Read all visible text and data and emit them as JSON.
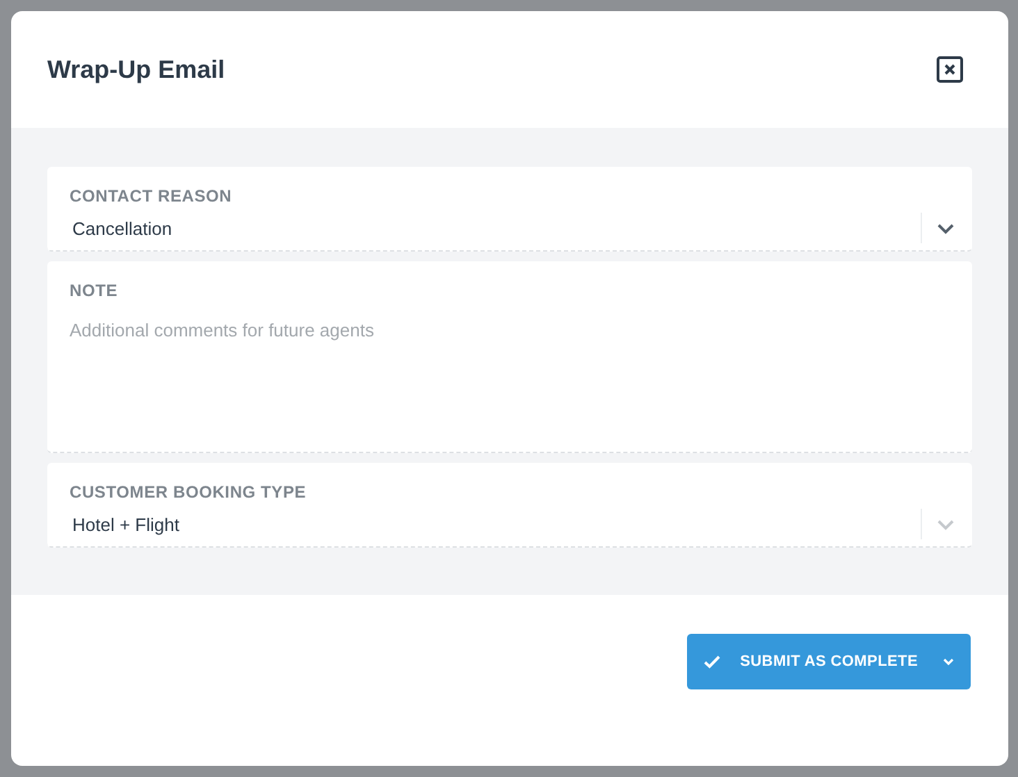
{
  "dialog": {
    "title": "Wrap-Up Email"
  },
  "fields": [
    {
      "kind": "select",
      "label": "CONTACT REASON",
      "value": "Cancellation"
    },
    {
      "kind": "textarea",
      "label": "NOTE",
      "placeholder": "Additional comments for future agents"
    },
    {
      "kind": "select",
      "label": "CUSTOMER BOOKING TYPE",
      "value": "Hotel + Flight"
    }
  ],
  "submit_button": {
    "label": "SUBMIT AS COMPLETE"
  }
}
